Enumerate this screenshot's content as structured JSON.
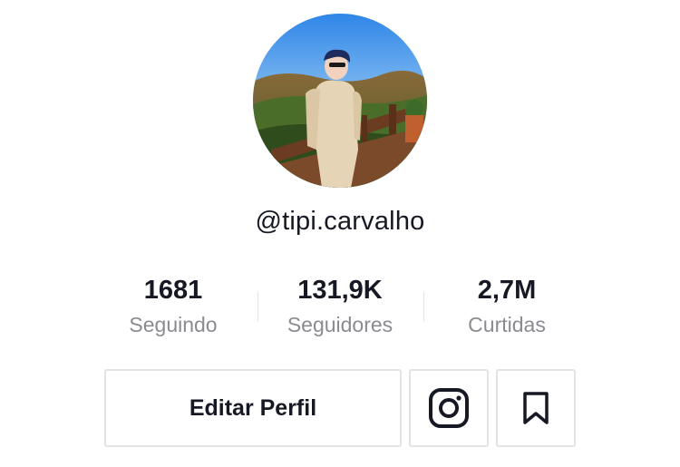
{
  "profile": {
    "avatar_icon": "profile-photo",
    "username": "@tipi.carvalho"
  },
  "stats": [
    {
      "value": "1681",
      "label": "Seguindo"
    },
    {
      "value": "131,9K",
      "label": "Seguidores"
    },
    {
      "value": "2,7M",
      "label": "Curtidas"
    }
  ],
  "actions": {
    "edit_profile_label": "Editar Perfil",
    "instagram_icon": "instagram-icon",
    "bookmark_icon": "bookmark-icon"
  },
  "colors": {
    "text_primary": "#161823",
    "text_secondary": "#8a8b91",
    "border": "#e3e3e4"
  }
}
